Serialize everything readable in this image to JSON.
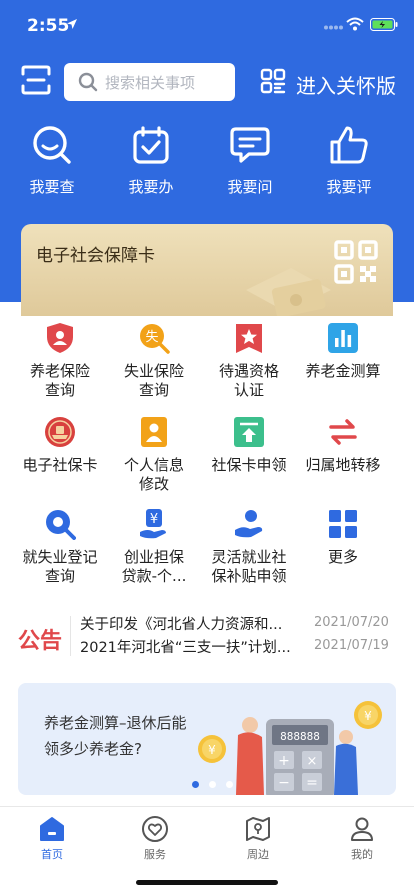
{
  "status": {
    "time": "2:55"
  },
  "header": {
    "search_placeholder": "搜索相关事项",
    "care_label": "进入关怀版",
    "quick_actions": [
      {
        "label": "我要查",
        "icon": "search-magnifier-icon"
      },
      {
        "label": "我要办",
        "icon": "calendar-check-icon"
      },
      {
        "label": "我要问",
        "icon": "chat-bubble-icon"
      },
      {
        "label": "我要评",
        "icon": "thumbs-up-icon"
      }
    ]
  },
  "card": {
    "title": "电子社会保障卡"
  },
  "services": [
    {
      "label": "养老保险\n查询",
      "icon": "shield-person-icon",
      "color": "#e0484b"
    },
    {
      "label": "失业保险\n查询",
      "icon": "unemployment-search-icon",
      "color": "#f2a218"
    },
    {
      "label": "待遇资格\n认证",
      "icon": "star-badge-icon",
      "color": "#e0484b"
    },
    {
      "label": "养老金测算",
      "icon": "bar-chart-icon",
      "color": "#2fa4e7"
    },
    {
      "label": "电子社保卡",
      "icon": "emblem-icon",
      "color": "#d8413e"
    },
    {
      "label": "个人信息\n修改",
      "icon": "id-card-icon",
      "color": "#f2a218"
    },
    {
      "label": "社保卡申领",
      "icon": "upload-card-icon",
      "color": "#3cbf8c"
    },
    {
      "label": "归属地转移",
      "icon": "transfer-arrows-icon",
      "color": "#e0484b"
    },
    {
      "label": "就失业登记\n查询",
      "icon": "magnifier-icon",
      "color": "#2f6ae0"
    },
    {
      "label": "创业担保\n贷款-个...",
      "icon": "yuan-hand-icon",
      "color": "#2f6ae0"
    },
    {
      "label": "灵活就业社\n保补贴申领",
      "icon": "person-hand-icon",
      "color": "#2f6ae0"
    },
    {
      "label": "更多",
      "icon": "grid-icon",
      "color": "#2f6ae0"
    }
  ],
  "notice": {
    "logo": "公告",
    "items": [
      {
        "title": "关于印发《河北省人力资源和...",
        "date": "2021/07/20"
      },
      {
        "title": "2021年河北省“三支一扶”计划...",
        "date": "2021/07/19"
      }
    ]
  },
  "banner": {
    "line1": "养老金测算–退休后能",
    "line2": "领多少养老金?",
    "calc_display": "888888",
    "slides": 3,
    "active_slide": 0
  },
  "tabs": [
    {
      "label": "首页",
      "icon": "home-icon",
      "active": true
    },
    {
      "label": "服务",
      "icon": "heart-circle-icon",
      "active": false
    },
    {
      "label": "周边",
      "icon": "map-pin-icon",
      "active": false
    },
    {
      "label": "我的",
      "icon": "person-icon",
      "active": false
    }
  ],
  "colors": {
    "brand": "#2f6ae0",
    "card_gold": "#e6d3a6",
    "notice_red": "#e0484b"
  }
}
